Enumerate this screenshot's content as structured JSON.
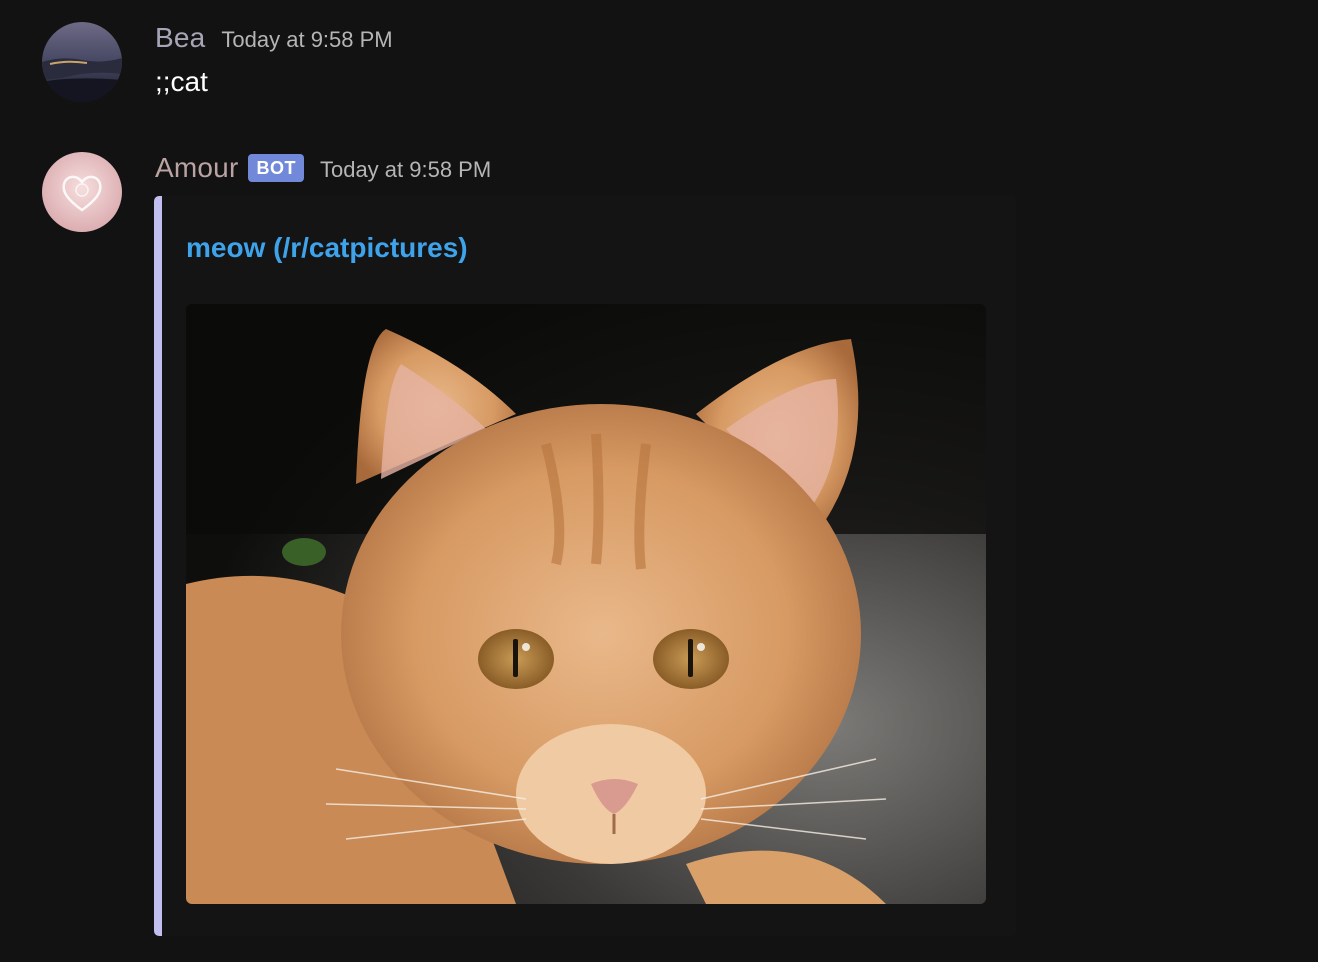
{
  "messages": [
    {
      "username": "Bea",
      "timestamp": "Today at 9:58 PM",
      "text": ";;cat",
      "avatar_icon": "user-avatar-sunset-photo"
    },
    {
      "username": "Amour",
      "badge": "BOT",
      "timestamp": "Today at 9:58 PM",
      "avatar_icon": "bot-avatar-heart",
      "embed": {
        "title": "meow (/r/catpictures)",
        "image_alt": "orange tabby kitten photo",
        "accent_color": "#c3bef0",
        "title_color": "#3fa3eb"
      }
    }
  ],
  "colors": {
    "background": "#121212",
    "badge": "#7289da"
  }
}
